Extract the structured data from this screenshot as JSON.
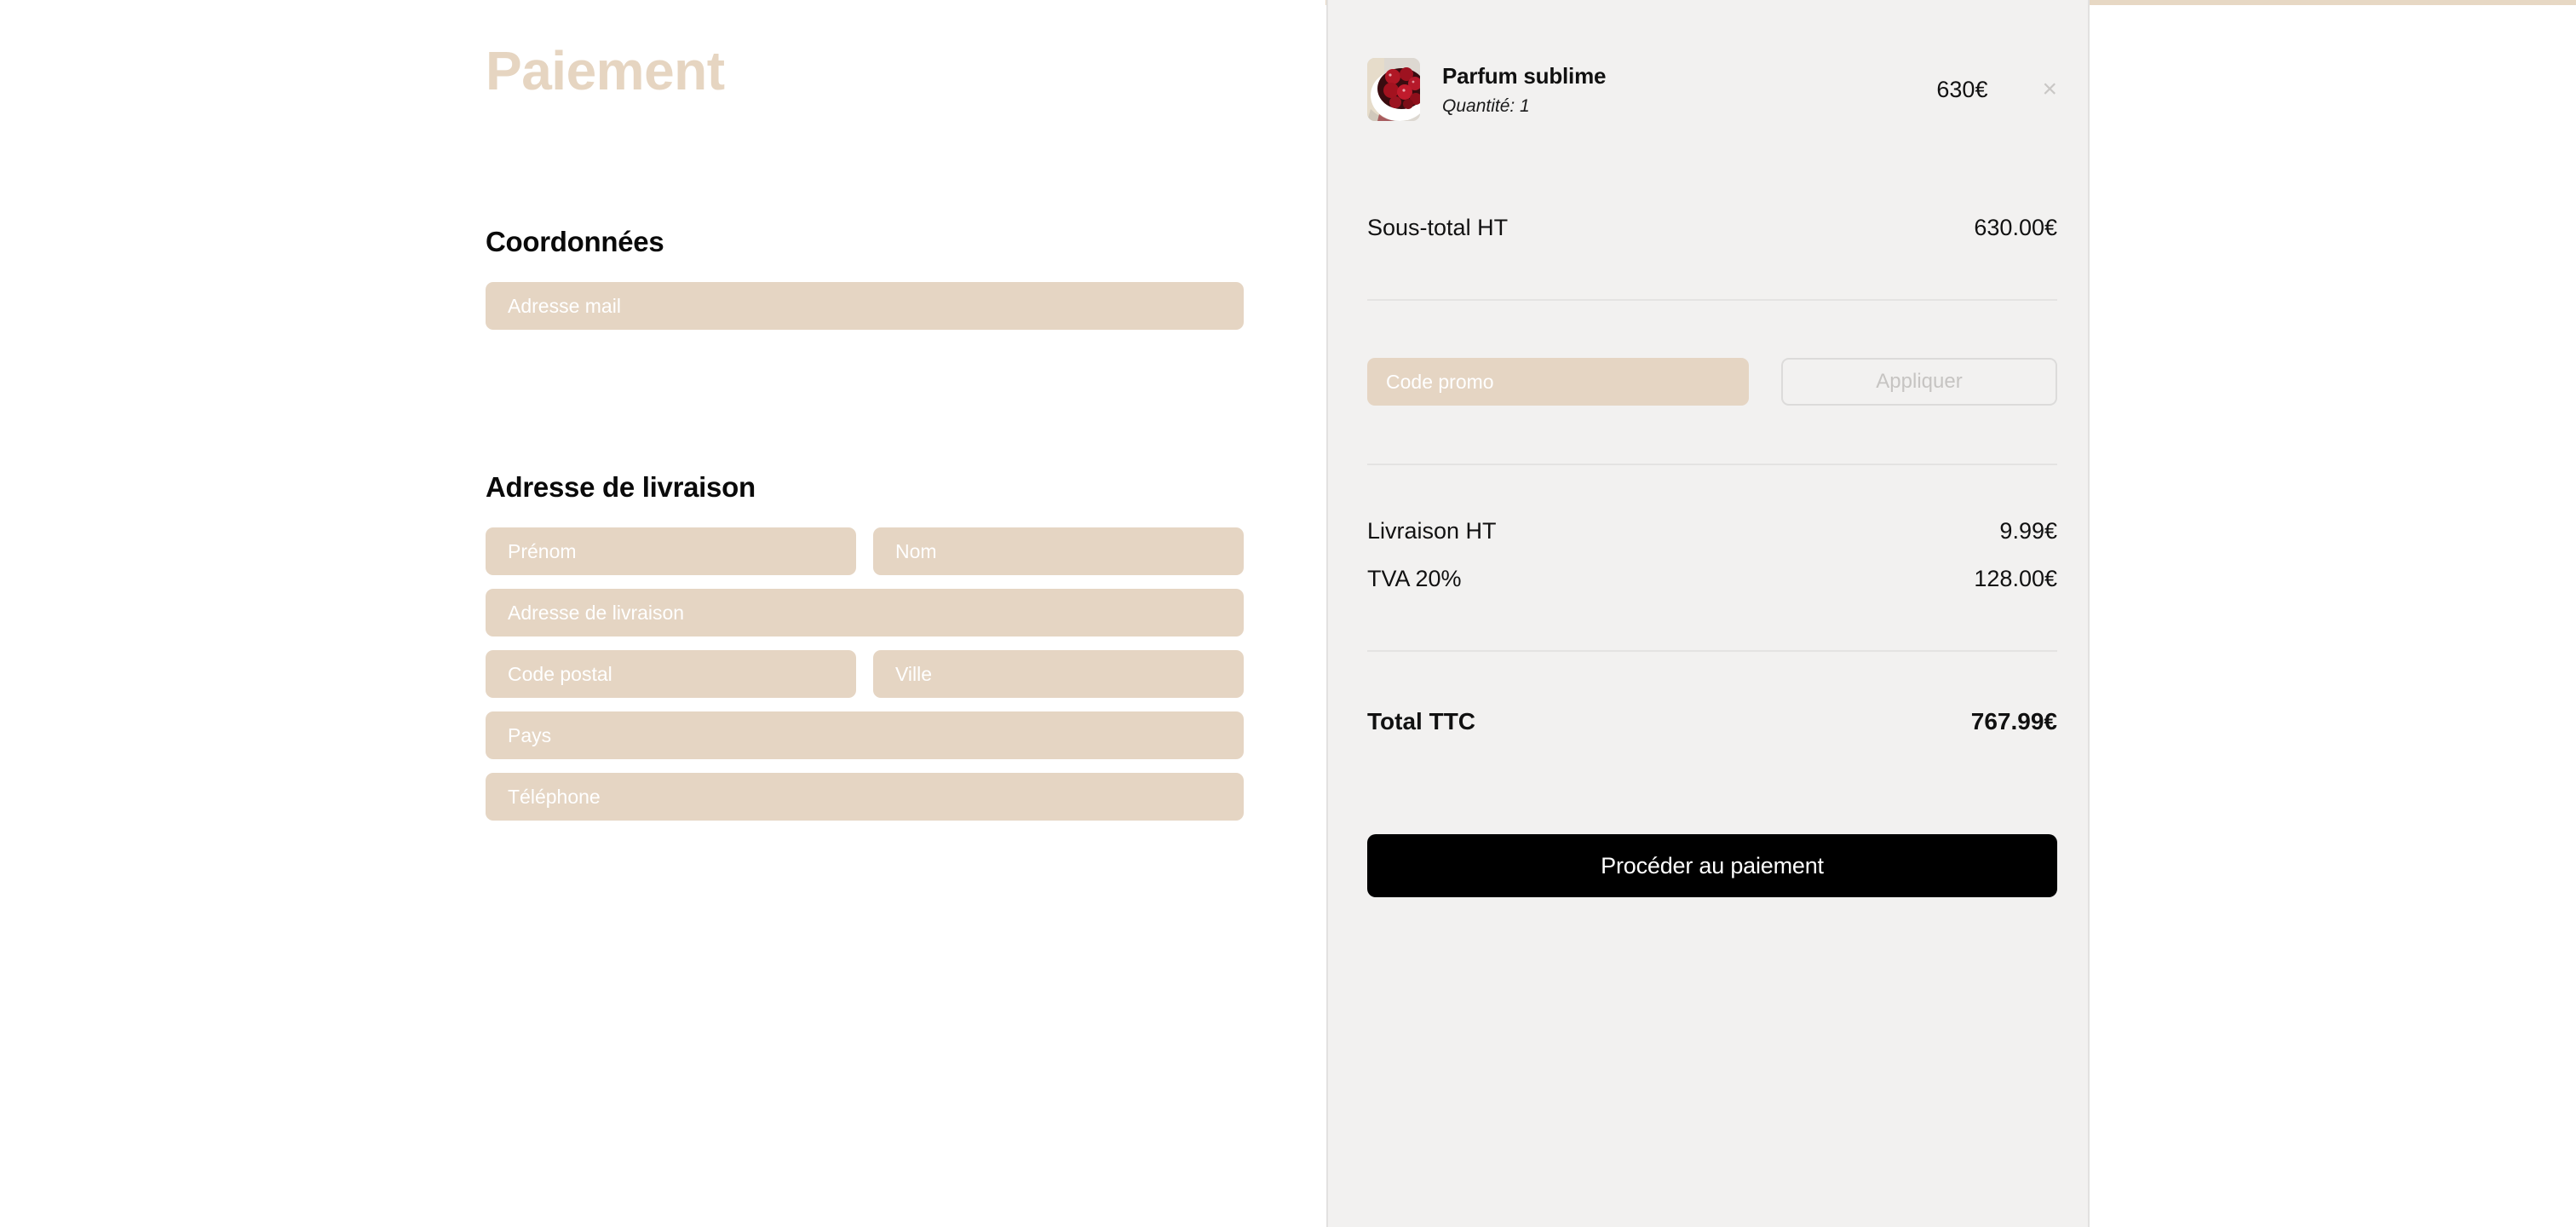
{
  "page": {
    "title": "Paiement"
  },
  "form": {
    "sections": [
      {
        "heading": "Coordonnées",
        "fields": [
          {
            "name": "email",
            "placeholder": "Adresse mail",
            "value": "",
            "width": "full"
          }
        ]
      },
      {
        "heading": "Adresse de livraison",
        "fields": [
          {
            "name": "first-name",
            "placeholder": "Prénom",
            "value": "",
            "width": "half"
          },
          {
            "name": "last-name",
            "placeholder": "Nom",
            "value": "",
            "width": "half"
          },
          {
            "name": "street-address",
            "placeholder": "Adresse de livraison",
            "value": "",
            "width": "full"
          },
          {
            "name": "postal-code",
            "placeholder": "Code postal",
            "value": "",
            "width": "half"
          },
          {
            "name": "city",
            "placeholder": "Ville",
            "value": "",
            "width": "half"
          },
          {
            "name": "country",
            "placeholder": "Pays",
            "value": "",
            "width": "full"
          },
          {
            "name": "phone",
            "placeholder": "Téléphone",
            "value": "",
            "width": "full"
          }
        ]
      }
    ]
  },
  "summary": {
    "cart_items": [
      {
        "name": "Parfum sublime",
        "quantity_label": "Quantité: 1",
        "price": "630€",
        "remove_icon": "close-icon",
        "thumbnail": "raspberries-in-white-bowl"
      }
    ],
    "subtotal": {
      "label": "Sous-total HT",
      "value": "630.00€"
    },
    "promo": {
      "placeholder": "Code promo",
      "value": "",
      "apply_label": "Appliquer"
    },
    "lines": [
      {
        "label": "Livraison HT",
        "value": "9.99€"
      },
      {
        "label": "TVA 20%",
        "value": "128.00€"
      }
    ],
    "total": {
      "label": "Total TTC",
      "value": "767.99€"
    },
    "pay_button": "Procéder au paiement"
  },
  "colors": {
    "accent_beige": "#e5d5c3",
    "title_beige": "#e6d5c1",
    "panel_bg": "#f2f1f0",
    "button_black": "#000000",
    "divider": "#e4e3e2"
  }
}
